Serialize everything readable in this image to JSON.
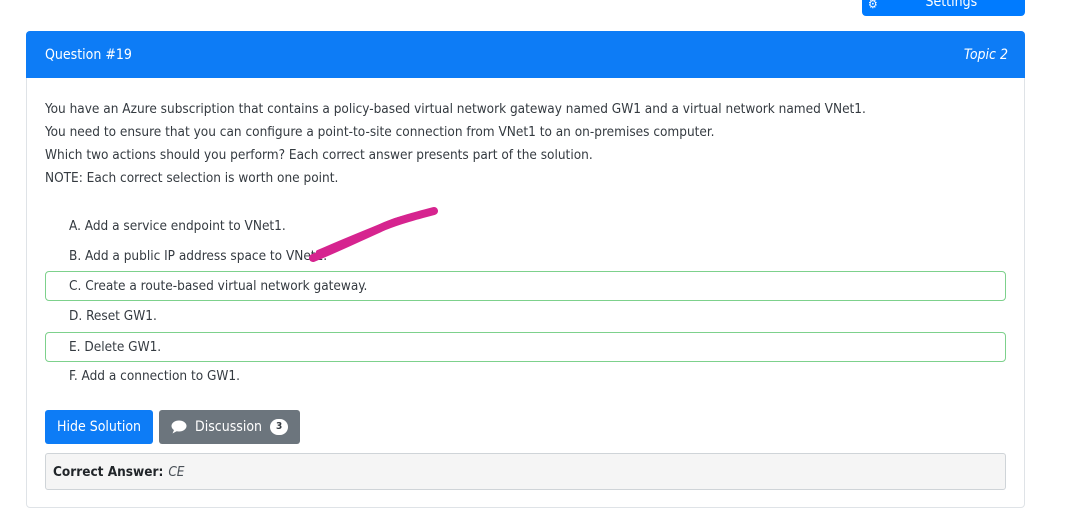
{
  "toolbar": {
    "custom_view_label": "Custom View Settings",
    "icon": "gear-icon"
  },
  "question": {
    "number_label": "Question #19",
    "topic_label": "Topic 2",
    "lines": [
      "You have an Azure subscription that contains a policy-based virtual network gateway named GW1 and a virtual network named VNet1.",
      "You need to ensure that you can configure a point-to-site connection from VNet1 to an on-premises computer.",
      "Which two actions should you perform? Each correct answer presents part of the solution.",
      "NOTE: Each correct selection is worth one point."
    ],
    "choices": [
      "A. Add a service endpoint to VNet1.",
      "B. Add a public IP address space to VNet1.",
      "C. Create a route-based virtual network gateway.",
      "D. Reset GW1.",
      "E. Delete GW1.",
      "F. Add a connection to GW1."
    ],
    "highlighted_choices": [
      "C",
      "E"
    ]
  },
  "actions": {
    "hide_solution_label": "Hide Solution",
    "discussion_label": "Discussion",
    "discussion_count": "3"
  },
  "answer": {
    "label": "Correct Answer:",
    "value": "CE"
  },
  "colors": {
    "primary": "#0d7cf6",
    "secondary": "#6c757d",
    "correct_border": "#7dd18c",
    "annotation": "#d6248f"
  }
}
